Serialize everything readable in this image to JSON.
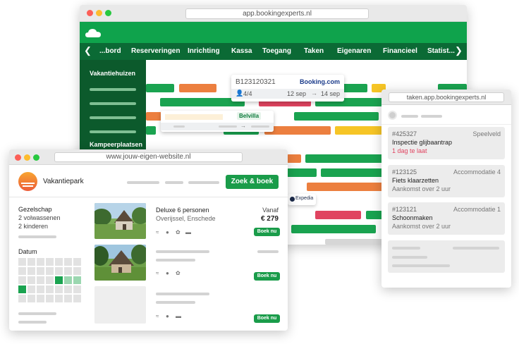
{
  "planner": {
    "url": "app.bookingexperts.nl",
    "nav": [
      "...bord",
      "Reserveringen",
      "Inrichting",
      "Kassa",
      "Toegang",
      "Taken",
      "Eigenaren",
      "Financieel",
      "Statist..."
    ],
    "sidebar": {
      "section1": "Vakantiehuizen",
      "section2": "Kampeerplaatsen"
    },
    "popup": {
      "code": "B123120321",
      "channel": "Booking.com",
      "guests": "4/4",
      "from": "12 sep",
      "arrow": "→",
      "to": "14 sep"
    },
    "popup2": {
      "channel": "Belvilla",
      "arrow": "→"
    },
    "expedia": "Expedia"
  },
  "website": {
    "url": "www.jouw-eigen-website.nl",
    "brand": "Vakantiepark",
    "cta": "Zoek & boek",
    "filters": {
      "company_title": "Gezelschap",
      "adults": "2 volwassenen",
      "children": "2 kinderen",
      "date_title": "Datum"
    },
    "listing": {
      "name": "Deluxe 6 personen",
      "location": "Overijssel, Enschede",
      "from_label": "Vanaf",
      "price": "€ 279",
      "book": "Boek nu"
    }
  },
  "tasks": {
    "url": "taken.app.bookingexperts.nl",
    "items": [
      {
        "id": "#425327",
        "category": "Speelveld",
        "title": "Inspectie glijbaantrap",
        "status": "1 dag te laat",
        "overdue": true
      },
      {
        "id": "#123125",
        "category": "Accommodatie 4",
        "title": "Fiets klaarzetten",
        "status": "Aankomst over 2 uur",
        "overdue": false
      },
      {
        "id": "#123121",
        "category": "Accommodatie 1",
        "title": "Schoonmaken",
        "status": "Aankomst over 2 uur",
        "overdue": false
      }
    ]
  },
  "colors": {
    "brand_green": "#0fa34c",
    "sidebar": "#0c5a2c",
    "booking": "#e05c2e",
    "overdue": "#e04460"
  }
}
